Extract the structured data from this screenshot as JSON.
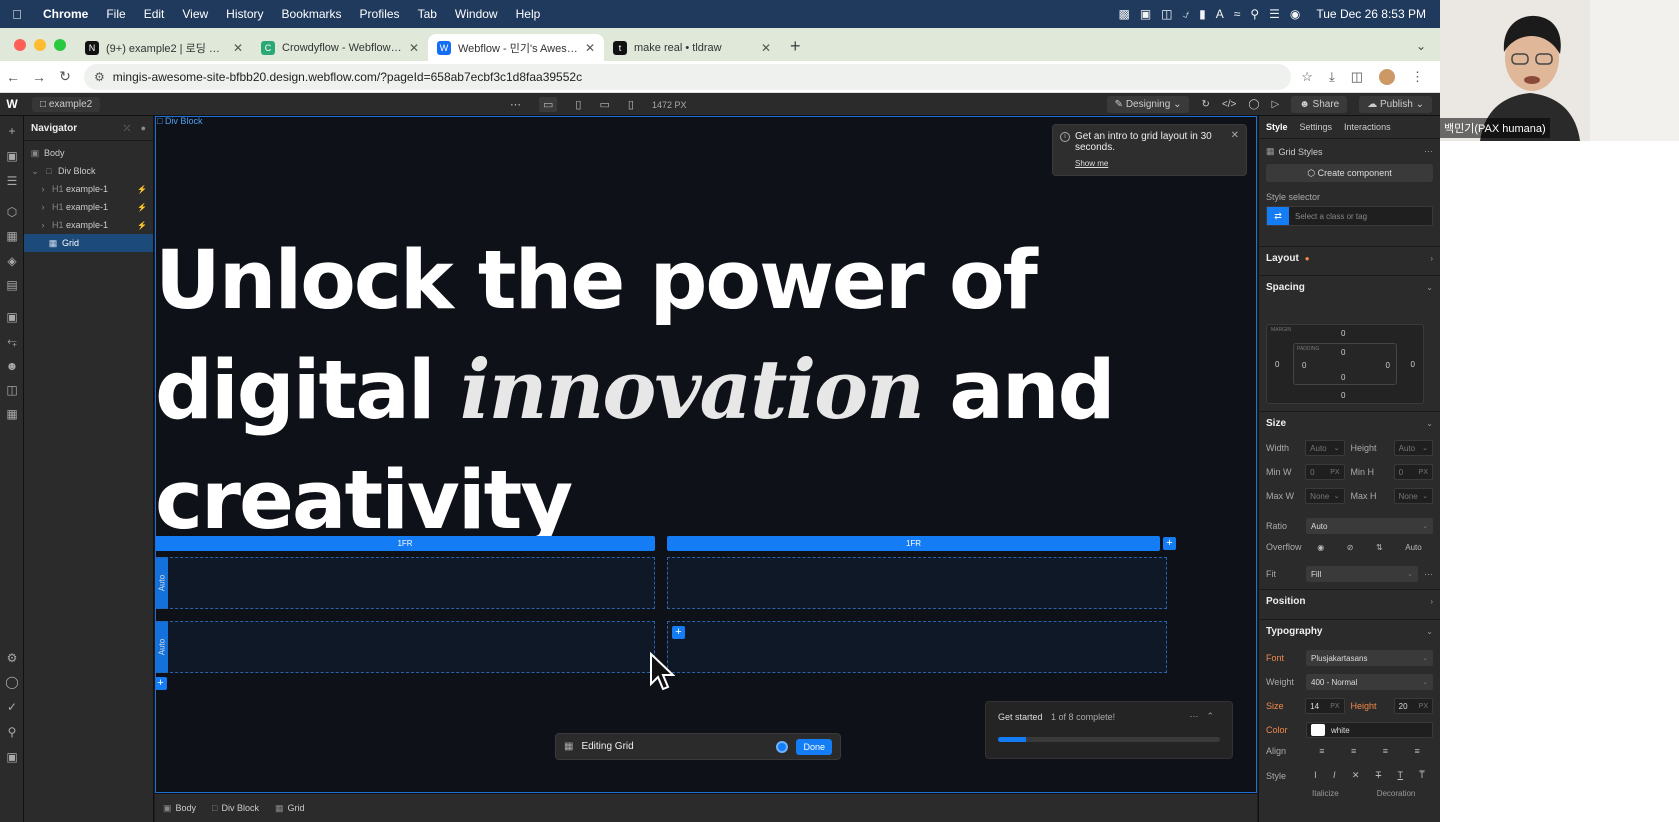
{
  "menubar": {
    "app": "Chrome",
    "items": [
      "File",
      "Edit",
      "View",
      "History",
      "Bookmarks",
      "Profiles",
      "Tab",
      "Window",
      "Help"
    ],
    "clock": "Tue Dec 26  8:53 PM"
  },
  "tabs": [
    {
      "title": "(9+) example2 | 로딩 후 페이드",
      "favicon": "N",
      "color": "#111111",
      "active": false
    },
    {
      "title": "Crowdyflow - Webflow HTML",
      "favicon": "C",
      "color": "#2aa876",
      "active": false
    },
    {
      "title": "Webflow - 민기's Awesome Site",
      "favicon": "W",
      "color": "#146ef5",
      "active": true
    },
    {
      "title": "make real • tldraw",
      "favicon": "t",
      "color": "#111111",
      "active": false
    }
  ],
  "address": {
    "url": "mingis-awesome-site-bfbb20.design.webflow.com/?pageId=658ab7ecbf3c1d8faa39552c"
  },
  "webflow": {
    "page_name": "example2",
    "canvas_width": "1472 PX",
    "mode": "Designing",
    "share": "Share",
    "publish": "Publish"
  },
  "navigator": {
    "title": "Navigator",
    "items": [
      {
        "label": "Body",
        "level": 0
      },
      {
        "label": "Div Block",
        "level": 1
      },
      {
        "label": "example-1",
        "level": 2,
        "tag": "H1"
      },
      {
        "label": "example-1",
        "level": 2,
        "tag": "H1"
      },
      {
        "label": "example-1",
        "level": 2,
        "tag": "H1"
      },
      {
        "label": "Grid",
        "level": 2,
        "selected": true
      }
    ]
  },
  "canvas": {
    "selected_label": "Div Block",
    "hero_line1": "Unlock the power of",
    "hero_line2a": "digital ",
    "hero_line2b": "innovation",
    "hero_line2c": " and",
    "hero_line3": "creativity",
    "col1": "1FR",
    "col2": "1FR",
    "row1": "Auto",
    "row2": "Auto",
    "plus": "+"
  },
  "toast": {
    "text": "Get an intro to grid layout in 30 seconds.",
    "link": "Show me"
  },
  "editing": {
    "label": "Editing Grid",
    "done": "Done"
  },
  "get_started": {
    "title": "Get started",
    "progress_text": "1 of 8 complete!",
    "progress": 0.125
  },
  "breadcrumbs": [
    "Body",
    "Div Block",
    "Grid"
  ],
  "style_panel": {
    "tabs": [
      "Style",
      "Settings",
      "Interactions"
    ],
    "grid_styles": "Grid Styles",
    "create_component": "Create component",
    "selector_label": "Style selector",
    "selector_placeholder": "Select a class or tag",
    "layout": "Layout",
    "spacing": "Spacing",
    "margin_label": "MARGIN",
    "padding_label": "PADDING",
    "zero": "0",
    "size": "Size",
    "width": "Width",
    "height": "Height",
    "minw": "Min W",
    "minh": "Min H",
    "maxw": "Max W",
    "maxh": "Max H",
    "auto": "Auto",
    "none": "None",
    "px": "PX",
    "ratio": "Ratio",
    "overflow": "Overflow",
    "fit": "Fit",
    "fill": "Fill",
    "position": "Position",
    "typography": "Typography",
    "font_label": "Font",
    "font_value": "Plusjakartasans",
    "weight_label": "Weight",
    "weight_value": "400 - Normal",
    "size_label": "Size",
    "size_value": "14",
    "lh_label": "Height",
    "lh_value": "20",
    "color_label": "Color",
    "color_value": "white",
    "align_label": "Align",
    "style_label": "Style",
    "italicize": "Italicize",
    "decoration": "Decoration"
  },
  "webcam": {
    "name": "백민기(PAX humana)"
  }
}
